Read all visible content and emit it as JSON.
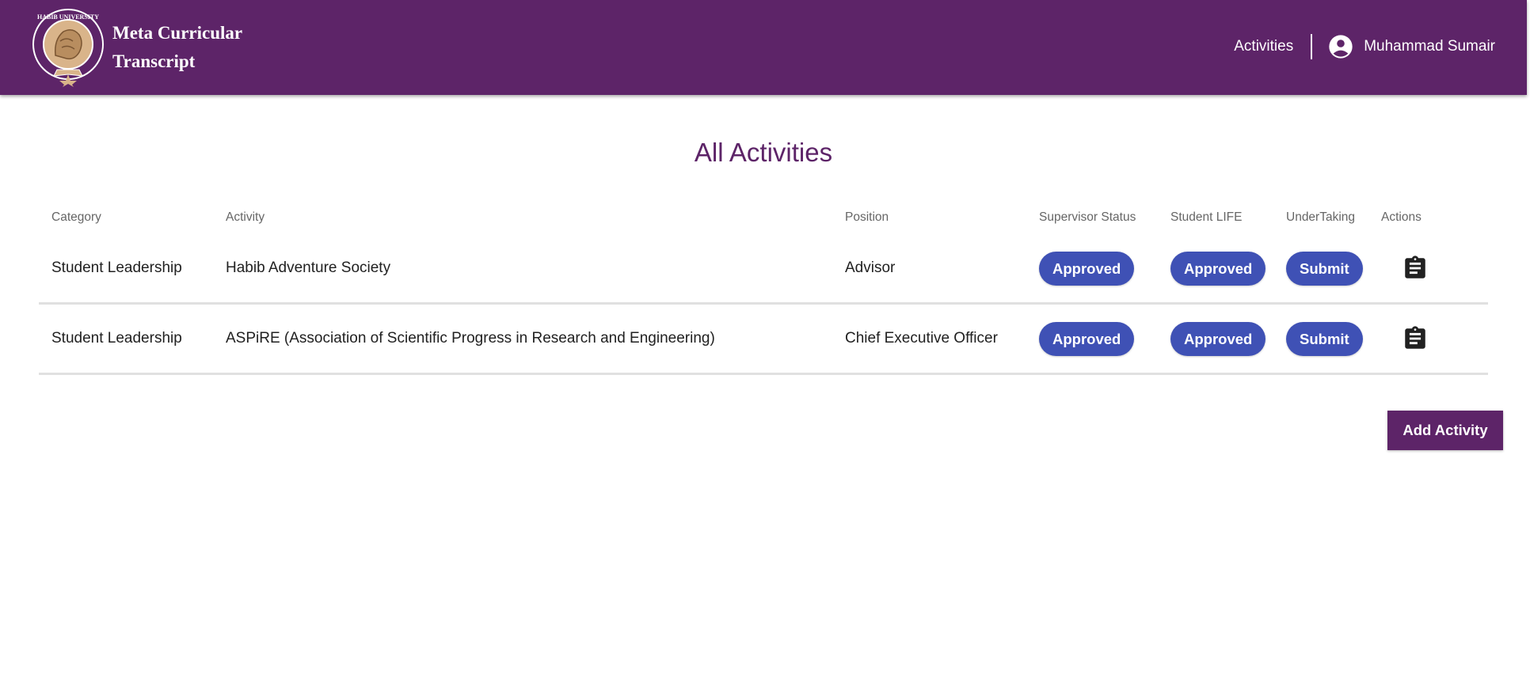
{
  "colors": {
    "primary": "#5d2468",
    "accent": "#3f51b5",
    "white": "#ffffff"
  },
  "header": {
    "logo_text": "HABIB UNIVERSITY",
    "brand_line1": "Meta Curricular",
    "brand_line2": "Transcript",
    "nav_activities": "Activities",
    "user_name": "Muhammad Sumair",
    "user_icon": "account-circle-icon"
  },
  "main": {
    "title": "All Activities",
    "table": {
      "columns": [
        "Category",
        "Activity",
        "Position",
        "Supervisor Status",
        "Student LIFE",
        "UnderTaking",
        "Actions"
      ],
      "rows": [
        {
          "category": "Student Leadership",
          "activity": "Habib Adventure Society",
          "position": "Advisor",
          "supervisor_status": "Approved",
          "student_life": "Approved",
          "undertaking": "Submit",
          "action_icon": "clipboard-icon"
        },
        {
          "category": "Student Leadership",
          "activity": "ASPiRE (Association of Scientific Progress in Research and Engineering)",
          "position": "Chief Executive Officer",
          "supervisor_status": "Approved",
          "student_life": "Approved",
          "undertaking": "Submit",
          "action_icon": "clipboard-icon"
        }
      ]
    },
    "add_button": "Add Activity"
  }
}
